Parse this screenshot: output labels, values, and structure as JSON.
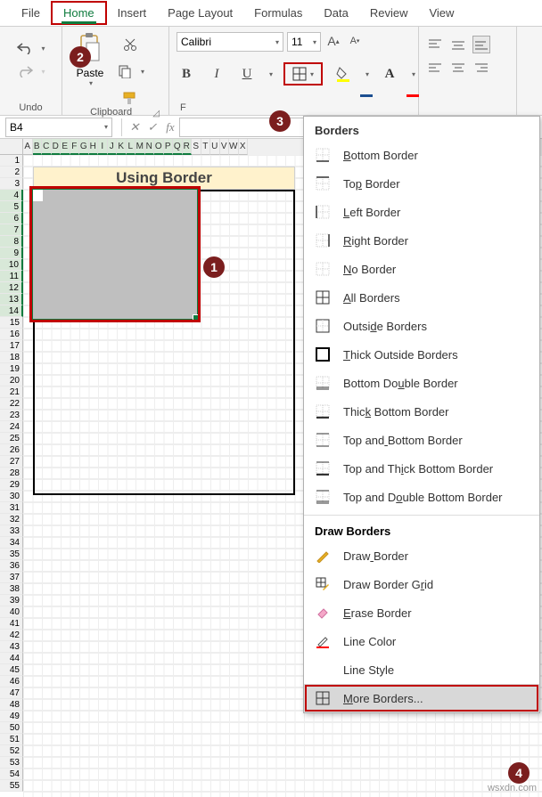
{
  "tabs": [
    "File",
    "Home",
    "Insert",
    "Page Layout",
    "Formulas",
    "Data",
    "Review",
    "View"
  ],
  "activeTab": "Home",
  "ribbon": {
    "undoGroup": "Undo",
    "clipboardGroup": "Clipboard",
    "pasteLabel": "Paste",
    "fontName": "Calibri",
    "fontSize": "11",
    "fontGroupPartial": "F"
  },
  "nameBox": "B4",
  "sheet": {
    "title": "Using Border",
    "cols": [
      "A",
      "B",
      "C",
      "D",
      "E",
      "F",
      "G",
      "H",
      "I",
      "J",
      "K",
      "L",
      "M",
      "N",
      "O",
      "P",
      "Q",
      "R",
      "S",
      "T",
      "U",
      "V",
      "W",
      "X"
    ],
    "rowStart": 1,
    "rowEnd": 55,
    "selRowsFrom": 4,
    "selRowsTo": 14,
    "selColsFrom": 1,
    "selColsTo": 17
  },
  "bordersMenu": {
    "title": "Borders",
    "items": [
      {
        "icon": "bottom",
        "label": "Bottom Border",
        "u": 0
      },
      {
        "icon": "top",
        "label": "Top Border",
        "u": 2
      },
      {
        "icon": "left",
        "label": "Left Border",
        "u": 0
      },
      {
        "icon": "right",
        "label": "Right Border",
        "u": 0
      },
      {
        "icon": "none",
        "label": "No Border",
        "u": 0
      },
      {
        "icon": "all",
        "label": "All Borders",
        "u": 0
      },
      {
        "icon": "outside",
        "label": "Outside Borders",
        "u": 5
      },
      {
        "icon": "thick",
        "label": "Thick Outside Borders",
        "u": 0
      },
      {
        "icon": "bdouble",
        "label": "Bottom Double Border",
        "u": 9
      },
      {
        "icon": "thickb",
        "label": "Thick Bottom Border",
        "u": 4
      },
      {
        "icon": "tb",
        "label": "Top and Bottom Border",
        "u": 7
      },
      {
        "icon": "ttb",
        "label": "Top and Thick Bottom Border",
        "u": 10
      },
      {
        "icon": "tdb",
        "label": "Top and Double Bottom Border",
        "u": 9
      }
    ],
    "drawTitle": "Draw Borders",
    "drawItems": [
      {
        "icon": "draw",
        "label": "Draw Border",
        "u": 4
      },
      {
        "icon": "drawgrid",
        "label": "Draw Border Grid",
        "u": 13
      },
      {
        "icon": "erase",
        "label": "Erase Border",
        "u": 0
      },
      {
        "icon": "linecolor",
        "label": "Line Color",
        "u": -1
      },
      {
        "icon": "linestyle",
        "label": "Line Style",
        "u": -1
      }
    ],
    "more": {
      "label": "More Borders...",
      "u": 0
    }
  },
  "callouts": {
    "c1": "1",
    "c2": "2",
    "c3": "3",
    "c4": "4"
  },
  "watermark": "wsxdn.com"
}
